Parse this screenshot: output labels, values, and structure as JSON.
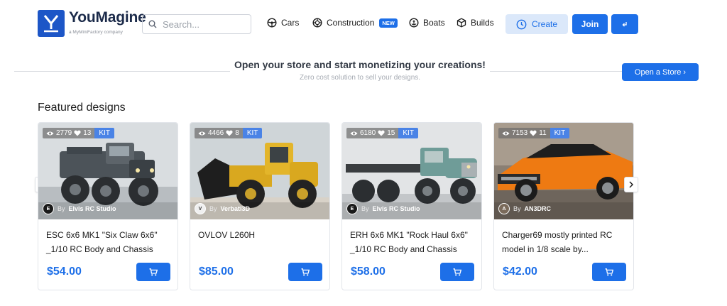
{
  "brand": {
    "name": "YouMagine",
    "tagline": "a MyMiniFactory company",
    "logo_letter": "Y",
    "color": "#1d56c7"
  },
  "search": {
    "placeholder": "Search..."
  },
  "nav": [
    {
      "label": "Cars",
      "icon": "steering-wheel-icon"
    },
    {
      "label": "Construction",
      "icon": "gear-wheel-icon",
      "badge": "NEW"
    },
    {
      "label": "Boats",
      "icon": "anchor-icon"
    },
    {
      "label": "Builds",
      "icon": "cube-icon"
    }
  ],
  "actions": {
    "create_label": "Create",
    "join_label": "Join",
    "login_icon": "login-arrow-icon"
  },
  "store_banner": {
    "title": "Open your store and start monetizing your creations!",
    "subtitle": "Zero cost solution to sell your designs.",
    "button_label": "Open a Store ›"
  },
  "featured": {
    "title": "Featured designs",
    "cards": [
      {
        "views": "2779",
        "likes": "13",
        "badge": "KIT",
        "by": "By",
        "author": "Elvis RC Studio",
        "author_initials": "E",
        "title": "ESC 6x6 MK1 \"Six Claw 6x6\" _1/10 RC Body and Chassis",
        "price": "$54.00"
      },
      {
        "views": "4466",
        "likes": "8",
        "badge": "KIT",
        "by": "By",
        "author": "Verbati3D",
        "author_initials": "V",
        "title": "OVLOV L260H",
        "price": "$85.00"
      },
      {
        "views": "6180",
        "likes": "15",
        "badge": "KIT",
        "by": "By",
        "author": "Elvis RC Studio",
        "author_initials": "E",
        "title": "ERH 6x6 MK1 \"Rock Haul 6x6\" _1/10 RC Body and Chassis",
        "price": "$58.00"
      },
      {
        "views": "7153",
        "likes": "11",
        "badge": "KIT",
        "by": "By",
        "author": "AN3DRC",
        "author_initials": "A",
        "title": "Charger69 mostly printed RC model in 1/8 scale by...",
        "price": "$42.00"
      }
    ]
  },
  "colors": {
    "accent": "#1d6fe8",
    "accent_light": "#dbe8fa",
    "kit_badge": "#4a83e6"
  }
}
